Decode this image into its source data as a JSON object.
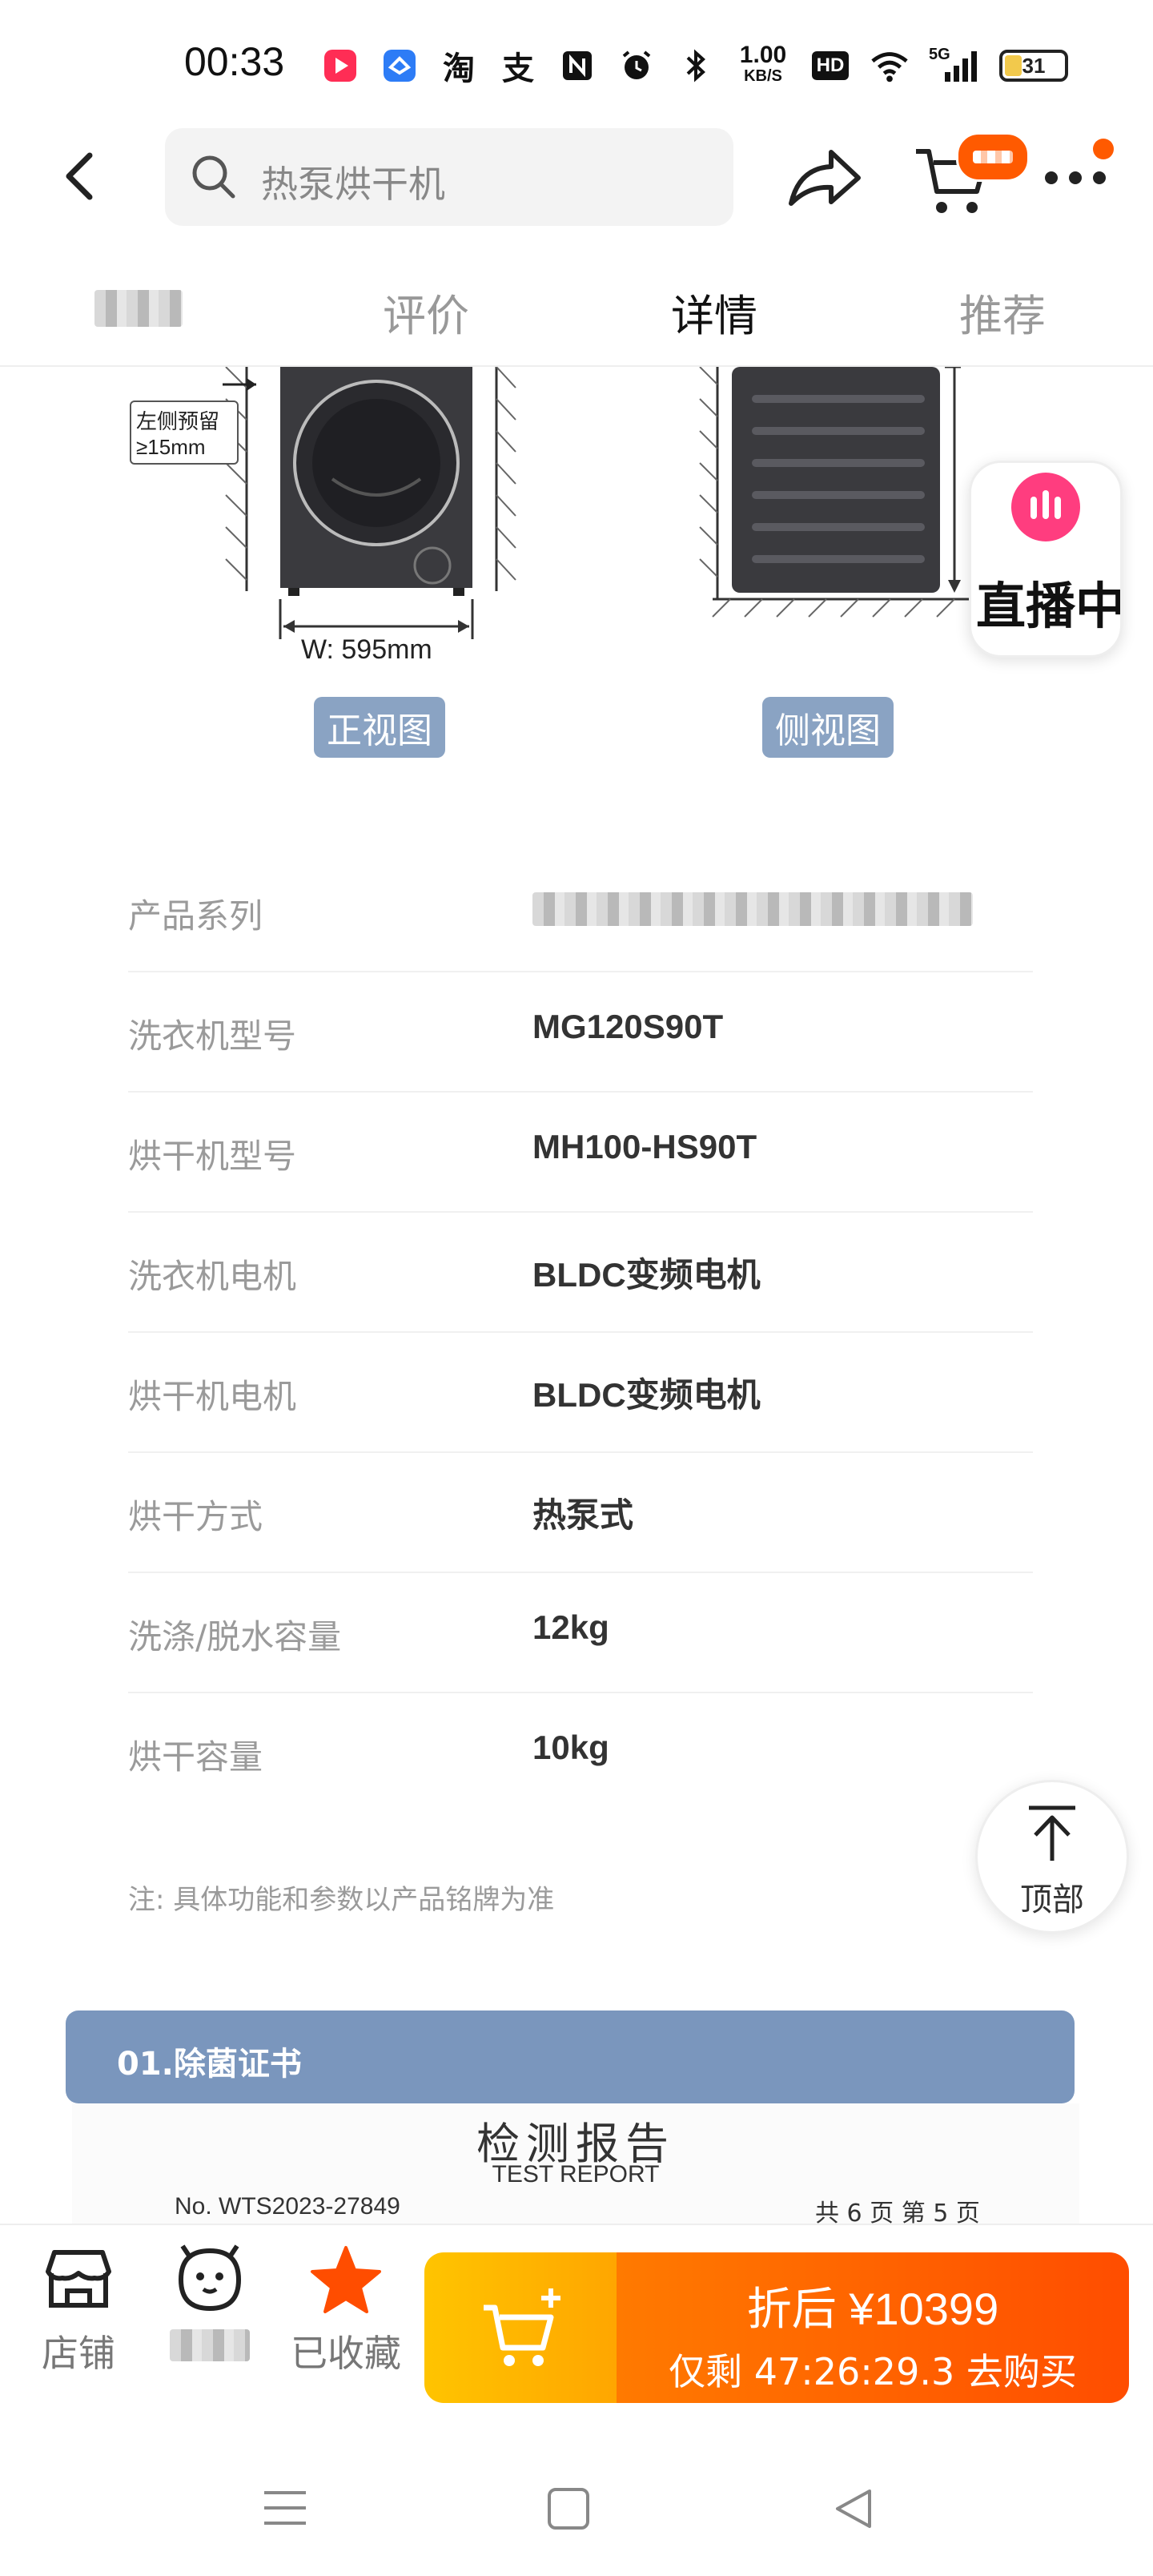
{
  "status_bar": {
    "time": "00:33",
    "net_speed_value": "1.00",
    "net_speed_unit": "KB/S",
    "hd_label": "HD",
    "signal_label": "5G",
    "battery_level": "31",
    "icons": [
      "video-app-icon",
      "browser-app-icon",
      "taobao-icon",
      "alipay-icon",
      "nfc-icon",
      "alarm-icon",
      "bluetooth-icon",
      "hd-icon",
      "wifi-icon",
      "signal-icon",
      "battery-icon"
    ]
  },
  "header": {
    "search_placeholder": "热泵烘干机",
    "cart_badge": "…",
    "icons": [
      "back-icon",
      "search-icon",
      "share-icon",
      "cart-icon",
      "more-icon"
    ]
  },
  "tabs": [
    {
      "label": "",
      "blurred": true
    },
    {
      "label": "评价"
    },
    {
      "label": "详情",
      "active": true
    },
    {
      "label": "推荐"
    }
  ],
  "diagram": {
    "left_clearance": "左侧预留",
    "left_clearance_value": "≥15mm",
    "width_label": "W: 595mm",
    "front_view": "正视图",
    "side_view": "侧视图"
  },
  "live_float": {
    "label": "直播中"
  },
  "specs": [
    {
      "label": "产品系列",
      "value": "",
      "blurred": true
    },
    {
      "label": "洗衣机型号",
      "value": "MG120S90T"
    },
    {
      "label": "烘干机型号",
      "value": "MH100-HS90T"
    },
    {
      "label": "洗衣机电机",
      "value": "BLDC变频电机"
    },
    {
      "label": "烘干机电机",
      "value": "BLDC变频电机"
    },
    {
      "label": "烘干方式",
      "value": "热泵式"
    },
    {
      "label": "洗涤/脱水容量",
      "value": "12kg"
    },
    {
      "label": "烘干容量",
      "value": "10kg"
    }
  ],
  "note": "注: 具体功能和参数以产品铭牌为准",
  "back_to_top": "顶部",
  "certificate": {
    "section_title": "01.除菌证书",
    "report_title": "检测报告",
    "report_title_en": "TEST REPORT",
    "report_no": "No. WTS2023-27849",
    "pages": "共 6 页 第 5 页"
  },
  "bottom_bar": {
    "store": "店铺",
    "service": "",
    "favorite": "已收藏",
    "price_label": "折后 ¥10399",
    "countdown": "仅剩 47:26:29.3 去购买"
  },
  "colors": {
    "accent_orange": "#ff5a00",
    "gold": "#ffbf00",
    "cert_blue": "#7a96bd",
    "badge_blue": "#8aa3c3",
    "live_pink": "#ff3d7f"
  }
}
